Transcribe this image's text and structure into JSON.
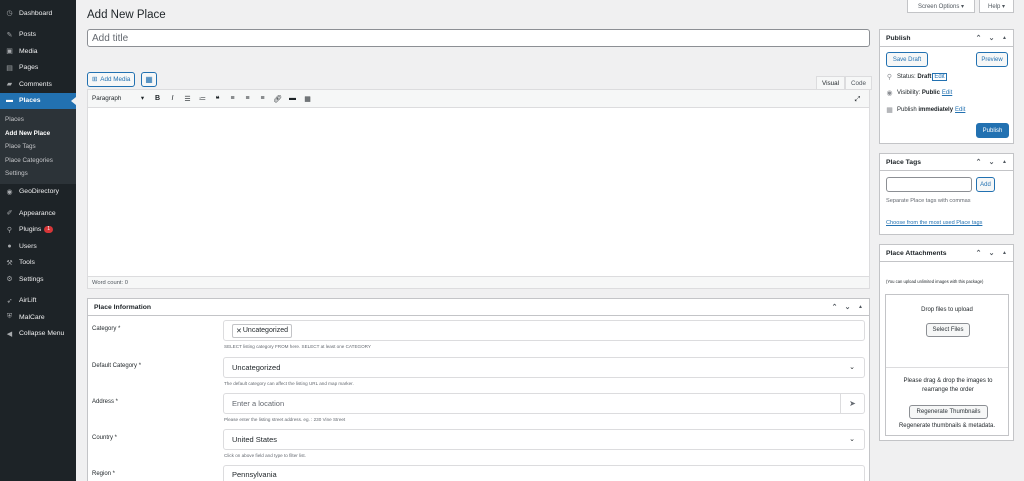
{
  "sidebar": {
    "dashboard": "Dashboard",
    "posts": "Posts",
    "media": "Media",
    "pages": "Pages",
    "comments": "Comments",
    "places": "Places",
    "places_sub": [
      "Places",
      "Add New Place",
      "Place Tags",
      "Place Categories",
      "Settings"
    ],
    "geodirectory": "GeoDirectory",
    "appearance": "Appearance",
    "plugins": "Plugins",
    "plugins_badge": "1",
    "users": "Users",
    "tools": "Tools",
    "settings": "Settings",
    "airlift": "AirLift",
    "malcare": "MalCare",
    "collapse": "Collapse Menu"
  },
  "header": {
    "title": "Add New Place",
    "screen_options": "Screen Options ▾",
    "help": "Help ▾"
  },
  "title_field": {
    "placeholder": "Add title"
  },
  "editor": {
    "add_media": "Add Media",
    "visual_tab": "Visual",
    "code_tab": "Code",
    "format": "Paragraph",
    "word_count": "Word count: 0"
  },
  "place_info": {
    "title": "Place Information",
    "category": {
      "label": "Category *",
      "chip": "Uncategorized",
      "help": "SELECT listing category FROM here. SELECT at least one CATEGORY"
    },
    "default_category": {
      "label": "Default Category *",
      "value": "Uncategorized",
      "help": "The default category can affect the listing URL and map marker."
    },
    "address": {
      "label": "Address *",
      "placeholder": "Enter a location",
      "help": "Please enter the listing street address. eg. : 230 Vine Street"
    },
    "country": {
      "label": "Country *",
      "value": "United States",
      "help": "Click on above field and type to filter list."
    },
    "region": {
      "label": "Region *",
      "value": "Pennsylvania"
    }
  },
  "publish": {
    "title": "Publish",
    "save_draft": "Save Draft",
    "preview": "Preview",
    "status_label": "Status:",
    "status_value": "Draft",
    "visibility_label": "Visibility:",
    "visibility_value": "Public",
    "publish_label": "Publish",
    "publish_value": "immediately",
    "edit": "Edit",
    "publish_button": "Publish"
  },
  "tags": {
    "title": "Place Tags",
    "add": "Add",
    "hint": "Separate Place tags with commas",
    "choose_link": "Choose from the most used Place tags"
  },
  "attachments": {
    "title": "Place Attachments",
    "note": "(You can upload unlimited images with this package)",
    "drop": "Drop files to upload",
    "select": "Select Files",
    "reorder": "Please drag & drop the images to rearrange the order",
    "regen_button": "Regenerate Thumbnails",
    "regen_text": "Regenerate thumbnails & metadata."
  },
  "colors": {
    "sidebar_bg": "#1d2327",
    "accent": "#2271b1",
    "page_bg": "#f0f0f1"
  }
}
